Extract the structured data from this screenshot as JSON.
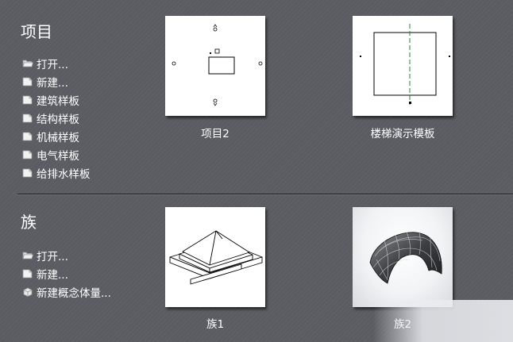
{
  "projects": {
    "title": "项目",
    "items": [
      {
        "label": "打开...",
        "icon": "open-folder-icon"
      },
      {
        "label": "新建...",
        "icon": "new-document-icon"
      },
      {
        "label": "建筑样板",
        "icon": "document-icon"
      },
      {
        "label": "结构样板",
        "icon": "document-icon"
      },
      {
        "label": "机械样板",
        "icon": "document-icon"
      },
      {
        "label": "电气样板",
        "icon": "document-icon"
      },
      {
        "label": "给排水样板",
        "icon": "document-icon"
      }
    ],
    "recent": [
      {
        "label": "项目2"
      },
      {
        "label": "楼梯演示模板"
      }
    ]
  },
  "families": {
    "title": "族",
    "items": [
      {
        "label": "打开...",
        "icon": "open-folder-icon"
      },
      {
        "label": "新建...",
        "icon": "new-document-icon"
      },
      {
        "label": "新建概念体量...",
        "icon": "mass-cube-icon"
      }
    ],
    "recent": [
      {
        "label": "族1"
      },
      {
        "label": "族2"
      }
    ]
  }
}
